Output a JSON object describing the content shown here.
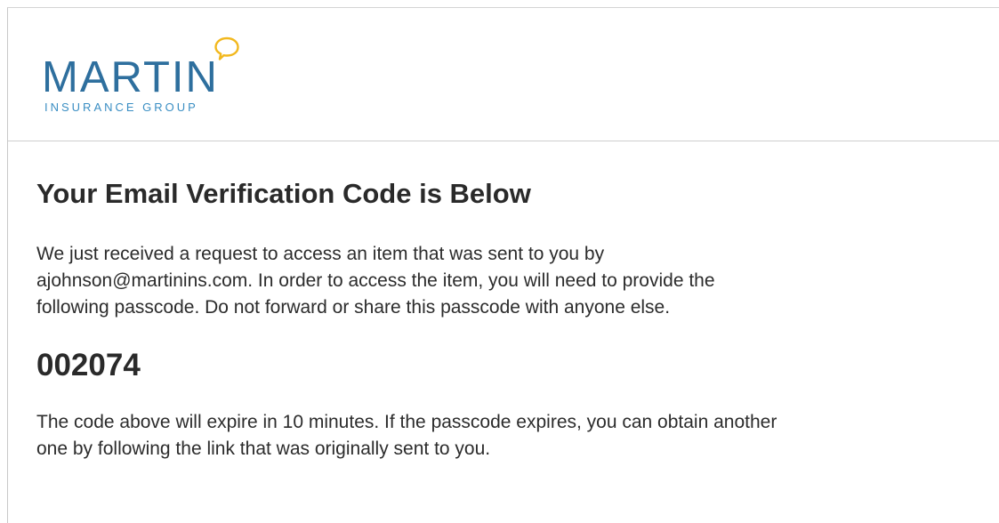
{
  "brand": {
    "name": "MARTIN",
    "subtitle": "INSURANCE GROUP",
    "primary_color": "#2e6f9e",
    "accent_color": "#f2b81e",
    "bubble_icon": "speech-bubble-icon"
  },
  "email": {
    "title": "Your Email Verification Code is Below",
    "intro_line1": "We just received a request to access an item that was sent to you by",
    "intro_line2": "ajohnson@martinins.com. In order to access the item, you will need to provide the",
    "intro_line3": "following passcode. Do not forward or share this passcode with anyone else.",
    "passcode": "002074",
    "expiry_line1": "The code above will expire in 10 minutes. If the passcode expires, you can obtain another",
    "expiry_line2": "one by following the link that was originally sent to you."
  }
}
